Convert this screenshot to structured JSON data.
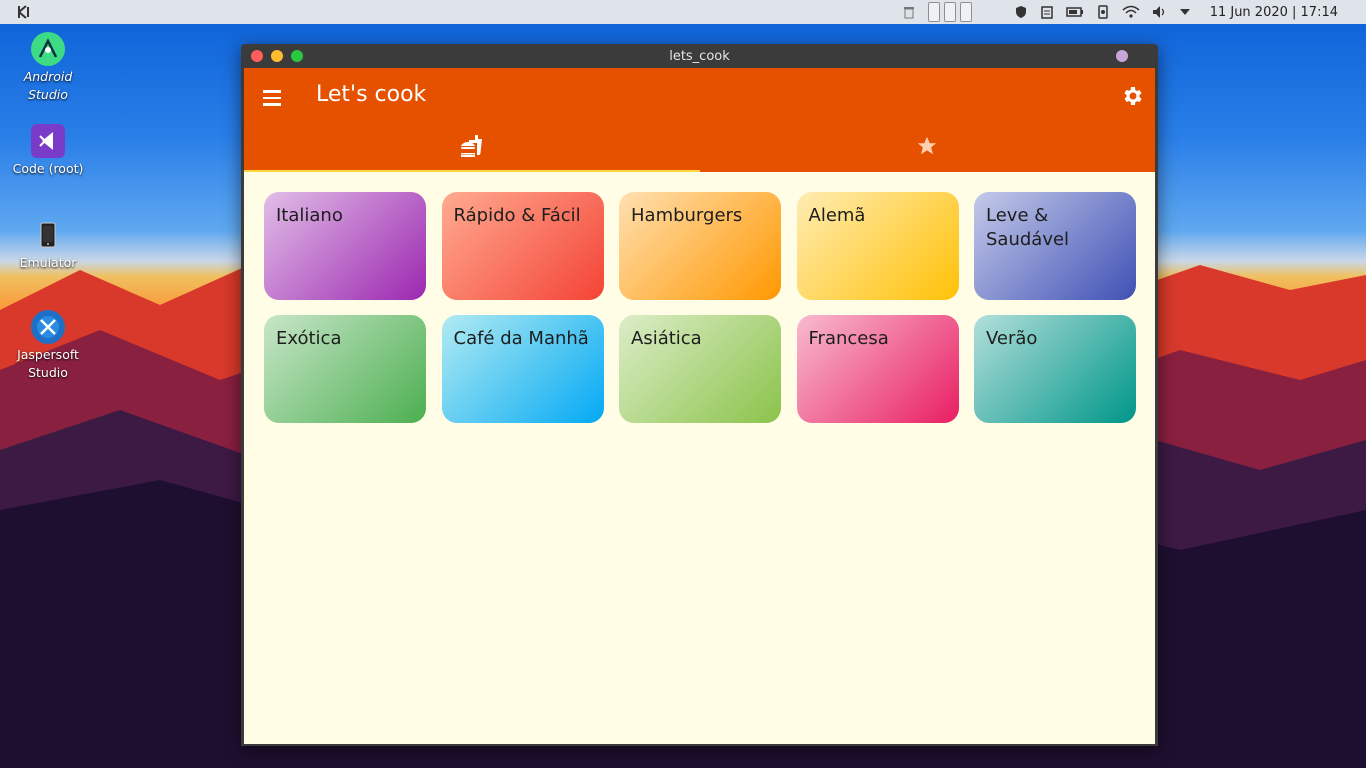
{
  "panel": {
    "clock": "11 Jun 2020 | 17:14",
    "icons": [
      "kde-menu-icon",
      "trash-icon",
      "shield-icon",
      "clipboard-icon",
      "battery-icon",
      "device-icon",
      "wifi-icon",
      "volume-icon",
      "expand-icon"
    ]
  },
  "desktop": {
    "icons": [
      {
        "label": "Android\nStudio",
        "icon": "android-studio-icon"
      },
      {
        "label": "Code (root)",
        "icon": "vscode-icon"
      },
      {
        "label": "Emulator",
        "icon": "phone-icon"
      },
      {
        "label": "Jaspersoft\nStudio",
        "icon": "jaspersoft-icon"
      }
    ]
  },
  "window": {
    "title": "lets_cook"
  },
  "app": {
    "title": "Let's cook",
    "tabs": [
      {
        "icon": "fastfood-icon",
        "active": true
      },
      {
        "icon": "star-icon",
        "active": false
      }
    ],
    "categories": [
      {
        "label": "Italiano",
        "from": "#e1bee7",
        "to": "#9c27b0"
      },
      {
        "label": "Rápido & Fácil",
        "from": "#ffab91",
        "to": "#f44336"
      },
      {
        "label": "Hamburgers",
        "from": "#ffe0b2",
        "to": "#ff9800"
      },
      {
        "label": "Alemã",
        "from": "#ffecb3",
        "to": "#ffc107"
      },
      {
        "label": "Leve & Saudável",
        "from": "#c5cae9",
        "to": "#3f51b5"
      },
      {
        "label": "Exótica",
        "from": "#c8e6c9",
        "to": "#4caf50"
      },
      {
        "label": "Café da Manhã",
        "from": "#b2ebf2",
        "to": "#03a9f4"
      },
      {
        "label": "Asiática",
        "from": "#dcedc8",
        "to": "#8bc34a"
      },
      {
        "label": "Francesa",
        "from": "#f8bbd0",
        "to": "#e91e63"
      },
      {
        "label": "Verão",
        "from": "#b2dfdb",
        "to": "#009688"
      }
    ]
  },
  "colors": {
    "appbar": "#e65100",
    "background": "#fffde6",
    "tab_indicator": "#ffd740"
  }
}
